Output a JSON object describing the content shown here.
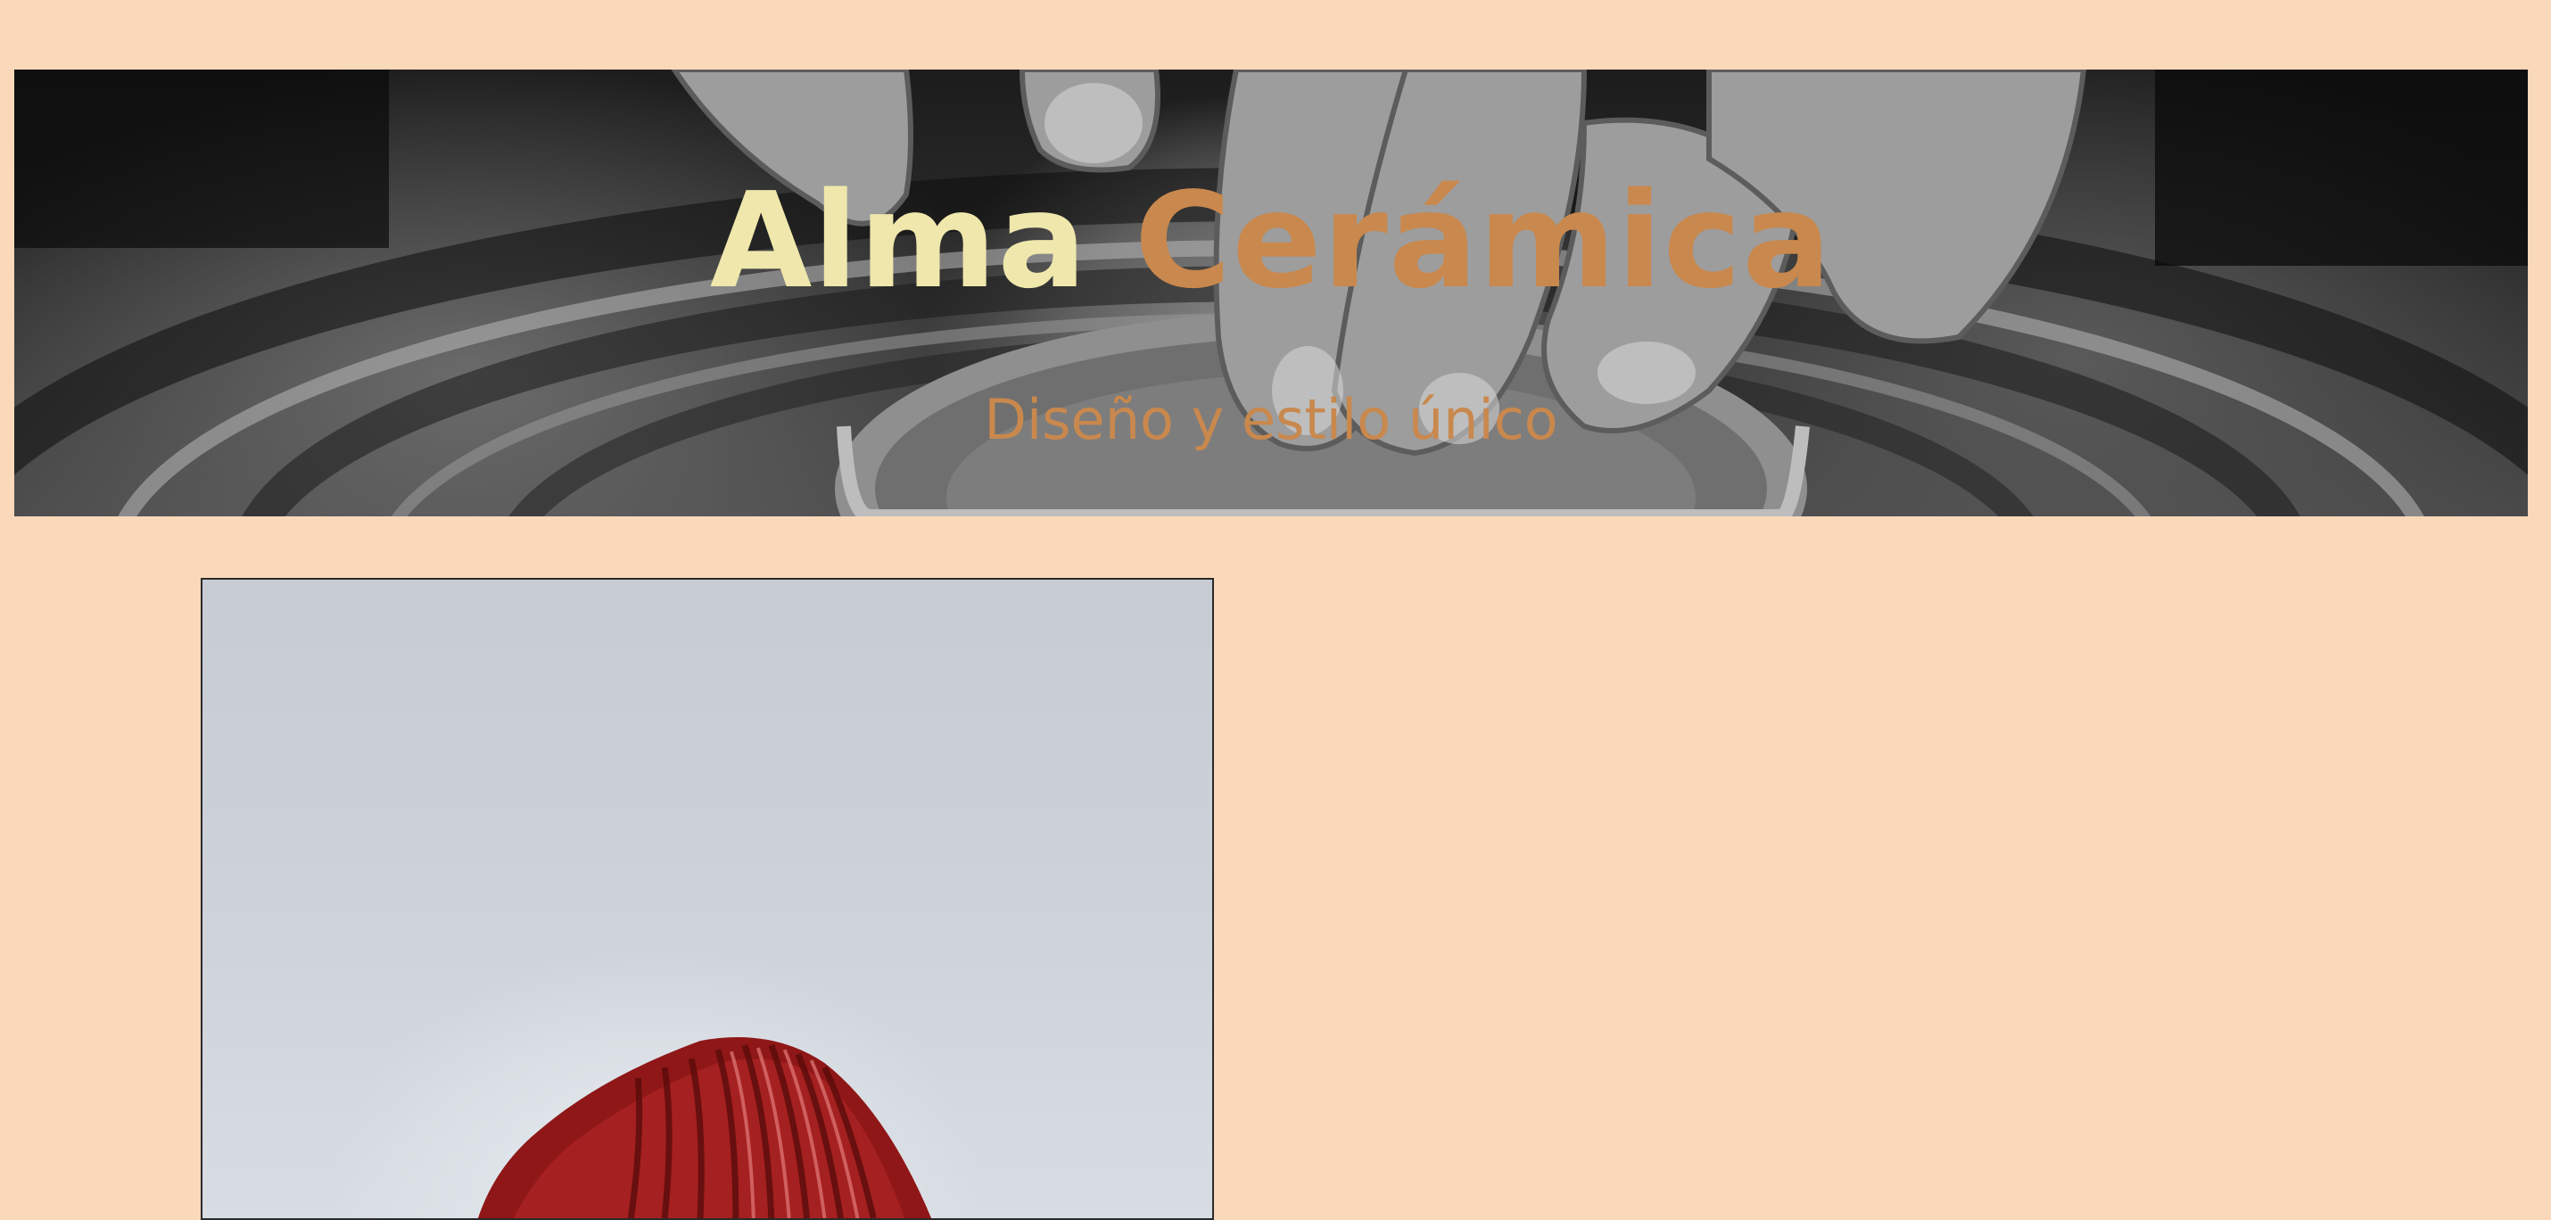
{
  "hero": {
    "title_word_1": "Alma",
    "title_word_2": "Cerámica",
    "subtitle": "Diseño y estilo único",
    "image_subject": "hands-shaping-clay-on-pottery-wheel"
  },
  "product": {
    "image_subject": "red-ribbed-ceramic-vase"
  },
  "colors": {
    "page_background": "#f9d9b9",
    "title_word_1": "#efe7ac",
    "title_accent": "#c9884d",
    "product_background": "#cdd2d9",
    "vase_red": "#9e1b1b"
  }
}
